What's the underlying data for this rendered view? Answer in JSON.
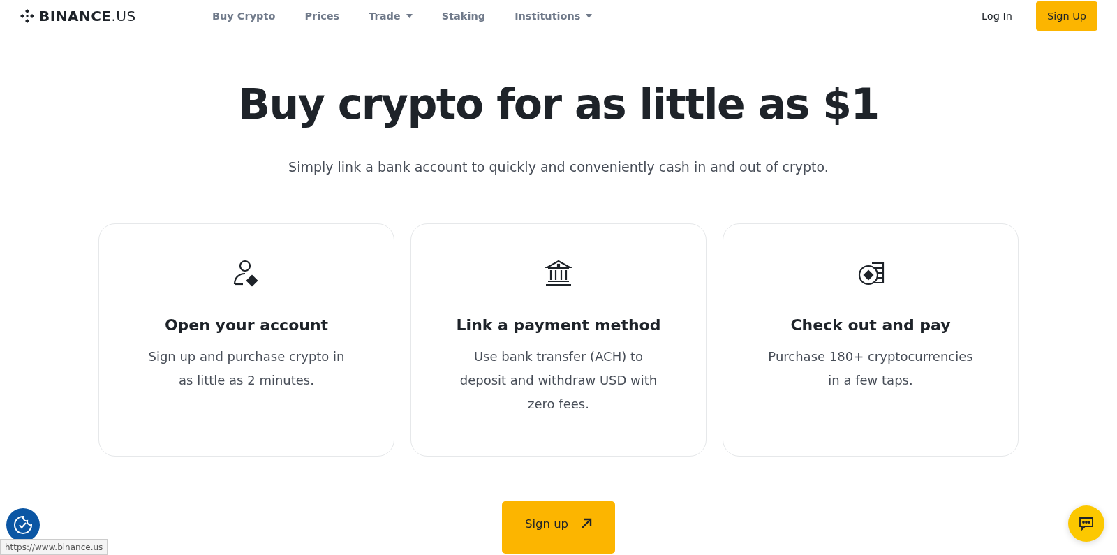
{
  "header": {
    "logo": "BINANCE",
    "logo_suffix": ".US",
    "nav": [
      {
        "label": "Buy Crypto",
        "dropdown": false
      },
      {
        "label": "Prices",
        "dropdown": false
      },
      {
        "label": "Trade",
        "dropdown": true
      },
      {
        "label": "Staking",
        "dropdown": false
      },
      {
        "label": "Institutions",
        "dropdown": true
      }
    ],
    "login": "Log In",
    "signup": "Sign Up"
  },
  "hero": {
    "title": "Buy crypto for as little as $1",
    "subtitle": "Simply link a bank account to quickly and conveniently cash in and out of crypto."
  },
  "cards": [
    {
      "kind": "account",
      "title": "Open your account",
      "text": "Sign up and purchase crypto in as little as 2 minutes."
    },
    {
      "kind": "bank",
      "title": "Link a payment method",
      "text": "Use bank transfer (ACH) to deposit and withdraw USD with zero fees."
    },
    {
      "kind": "coins",
      "title": "Check out and pay",
      "text": "Purchase 180+ cryptocurrencies in a few taps."
    }
  ],
  "cta": "Sign up",
  "status_bar": "https://www.binance.us"
}
